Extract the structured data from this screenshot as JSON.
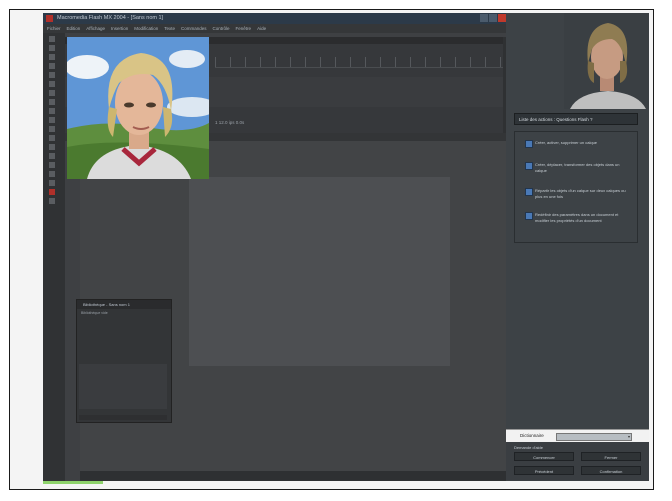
{
  "window": {
    "title": "Macromedia Flash MX 2004 - [Sans nom 1]"
  },
  "menu": [
    "Fichier",
    "Edition",
    "Affichage",
    "Insertion",
    "Modification",
    "Texte",
    "Commandes",
    "Contrôle",
    "Fenêtre",
    "Aide"
  ],
  "timeline": {
    "status": "1  12.0 ips  0.0s"
  },
  "library": {
    "title": "Bibliothèque - Sans nom 1",
    "subtitle": "Bibliothèque vide"
  },
  "right_panel": {
    "header": "Liste des actions : Questions Flash ?",
    "items": [
      "Créer, activer, supprimer un calque",
      "Créer, déplacer, transformer des objets dans un calque",
      "Répartir les objets d'un calque sur deux calques ou plus en une fois",
      "Redéfinir des paramètres dans un document et modifier les propriétés d'un document"
    ],
    "dictionary_label": "Dictionnaire",
    "actions_title": "Demande d'aide",
    "buttons": [
      "Commencer",
      "Fermer",
      "Précédent",
      "Confirmation"
    ]
  },
  "icons": [
    "app-logo-icon",
    "minimize-icon",
    "maximize-icon",
    "close-icon",
    "checkbox-icon",
    "chevron-down-icon"
  ]
}
